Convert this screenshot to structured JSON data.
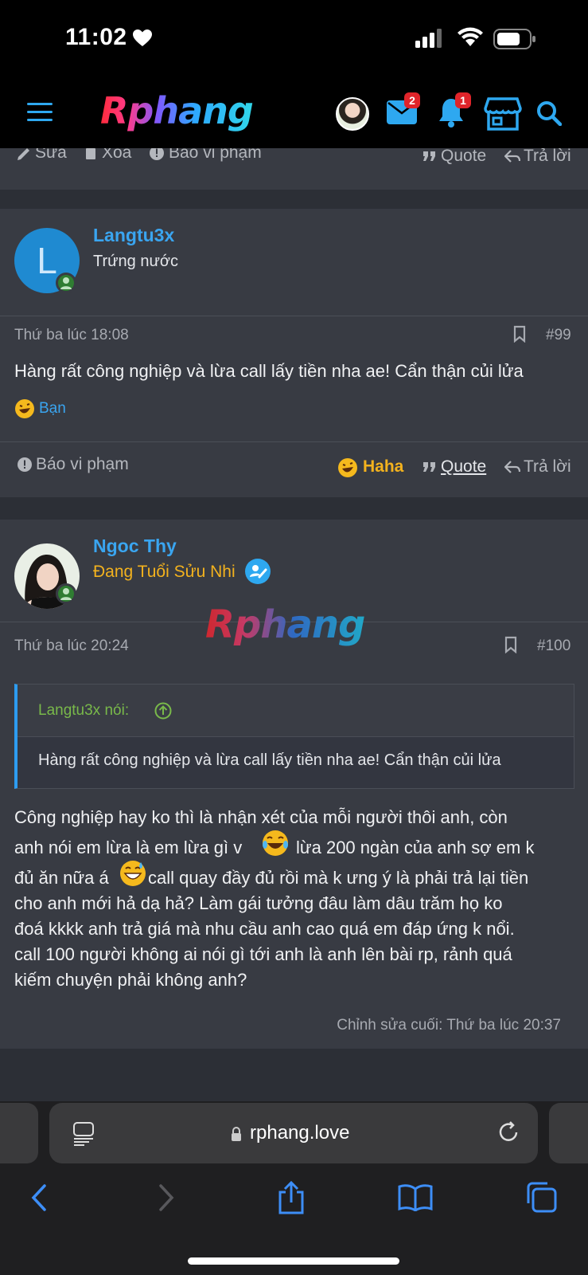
{
  "status": {
    "time": "11:02"
  },
  "nav": {
    "logo": "Rphang",
    "mail_badge": "2",
    "bell_badge": "1"
  },
  "top_actions": {
    "edit": "Sửa",
    "delete": "Xóa",
    "report": "Báo vi phạm",
    "quote": "Quote",
    "reply": "Trả lời"
  },
  "post99": {
    "avatar_letter": "L",
    "username": "Langtu3x",
    "user_title": "Trứng nước",
    "date": "Thứ ba lúc 18:08",
    "number": "#99",
    "text": "Hàng rất công nghiệp và lừa call lấy tiền nha ae! Cẩn thận củi lửa",
    "reaction_by": "Bạn",
    "report": "Báo vi phạm",
    "haha": "Haha",
    "quote": "Quote",
    "reply": "Trả lời"
  },
  "post100": {
    "username": "Ngoc Thy",
    "user_title": "Đang Tuổi Sửu Nhi",
    "watermark": "Rphang",
    "date": "Thứ ba lúc 20:24",
    "number": "#100",
    "quote_author": "Langtu3x nói:",
    "quote_text": "Hàng rất công nghiệp và lừa call lấy tiền nha ae! Cẩn thận củi lửa",
    "lines": [
      "Công nghiệp hay ko thì là nhận xét của mỗi người thôi anh, còn",
      "anh nói em lừa là em lừa gì v",
      "lừa 200 ngàn của anh sợ em k",
      "đủ ăn nữa á",
      "call quay đầy đủ rồi mà k ưng ý là phải trả lại tiền",
      "cho anh mới hả dạ hả? Làm gái tưởng đâu làm dâu trăm họ ko",
      "đoá kkkk anh trả giá mà nhu cầu anh cao quá em đáp ứng k nổi.",
      "call 100 người không ai nói gì tới anh là anh lên bài rp, rảnh quá",
      "kiếm chuyện phải không anh?"
    ],
    "edited": "Chỉnh sửa cuối: Thứ ba lúc 20:37"
  },
  "browser": {
    "url": "rphang.love"
  },
  "colors": {
    "link": "#3aa5f0",
    "gold": "#f3b21e",
    "quote_border": "#2d9cf0"
  }
}
